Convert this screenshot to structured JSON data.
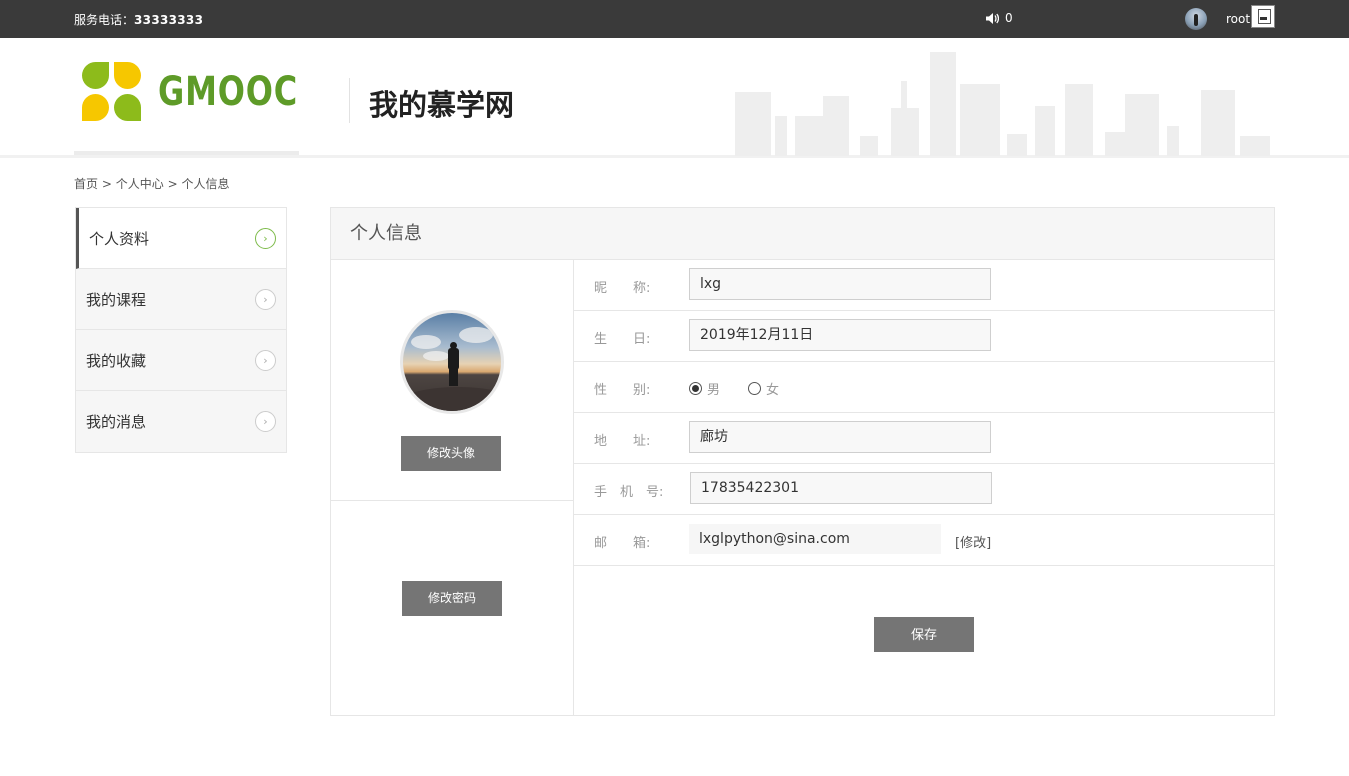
{
  "topbar": {
    "phone_label": "服务电话：",
    "phone_number": "33333333",
    "message_count": "0",
    "username": "root"
  },
  "header": {
    "logo_text": "GMOOC",
    "page_heading": "我的慕学网"
  },
  "breadcrumb": {
    "home": "首页",
    "sep1": ">",
    "center": "个人中心",
    "sep2": ">",
    "current": "个人信息"
  },
  "sidebar": {
    "items": [
      {
        "label": "个人资料",
        "active": true
      },
      {
        "label": "我的课程",
        "active": false
      },
      {
        "label": "我的收藏",
        "active": false
      },
      {
        "label": "我的消息",
        "active": false
      }
    ]
  },
  "panel": {
    "title": "个人信息",
    "change_avatar_label": "修改头像",
    "change_password_label": "修改密码",
    "save_label": "保存"
  },
  "form": {
    "nickname_label": "昵　　称:",
    "nickname_value": "lxg",
    "birthday_label": "生　　日:",
    "birthday_value": "2019年12月11日",
    "gender_label": "性　　别:",
    "gender_options": [
      "男",
      "女"
    ],
    "gender_selected": "男",
    "address_label": "地　　址:",
    "address_value": "廊坊",
    "mobile_label": "手　机　号:",
    "mobile_value": "17835422301",
    "email_label": "邮　　箱:",
    "email_value": "lxglpython@sina.com",
    "email_edit_label": "[修改]"
  },
  "colors": {
    "topbar_bg": "#3a3a3a",
    "logo_green": "#5e9b28",
    "button_gray": "#757575",
    "active_chevron": "#7dbb4a"
  },
  "icons": {
    "sound": "speaker-icon",
    "file": "file-icon",
    "chevron": "chevron-right-icon"
  }
}
